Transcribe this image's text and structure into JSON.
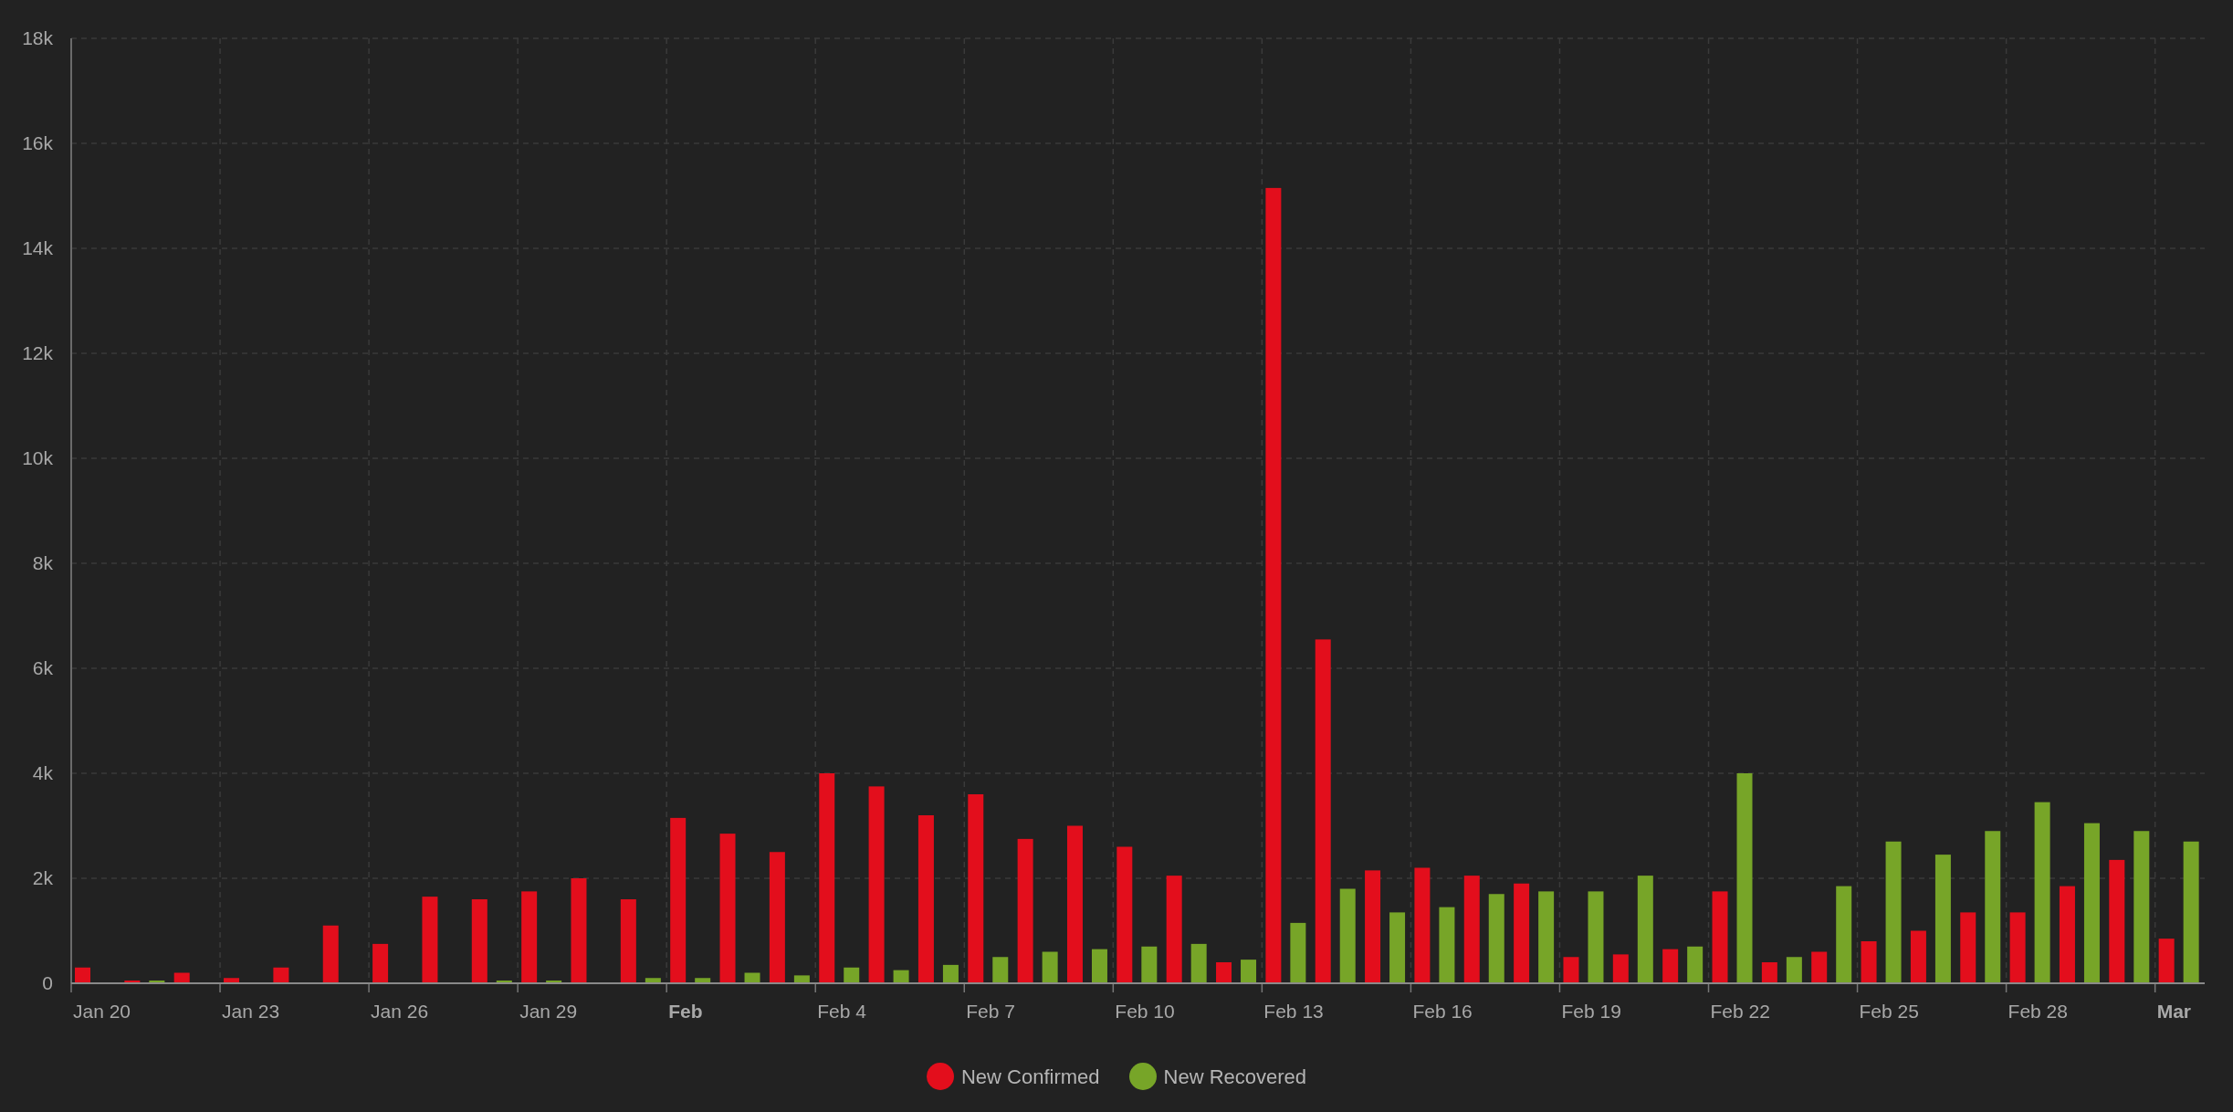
{
  "chart_data": {
    "type": "bar",
    "orientation": "vertical",
    "stacked": false,
    "grid": true,
    "categories": [
      "Jan 20",
      null,
      null,
      "Jan 23",
      null,
      null,
      "Jan 26",
      null,
      null,
      "Jan 29",
      null,
      null,
      "Feb",
      null,
      null,
      "Feb 4",
      null,
      null,
      "Feb 7",
      null,
      null,
      "Feb 10",
      null,
      null,
      "Feb 13",
      null,
      null,
      "Feb 16",
      null,
      null,
      "Feb 19",
      null,
      null,
      "Feb 22",
      null,
      null,
      "Feb 25",
      null,
      null,
      "Feb 28",
      null,
      null,
      "Mar"
    ],
    "series": [
      {
        "name": "New Confirmed",
        "color": "#e30e1c",
        "values": [
          300,
          50,
          200,
          100,
          300,
          1100,
          750,
          1650,
          1600,
          1750,
          2000,
          1600,
          3150,
          2850,
          2500,
          4000,
          3750,
          3200,
          3600,
          2750,
          3000,
          2600,
          2050,
          400,
          15150,
          6550,
          2150,
          2200,
          2050,
          1900,
          500,
          550,
          650,
          1750,
          400,
          600,
          800,
          1000,
          1350,
          1350,
          1850,
          2350,
          850
        ]
      },
      {
        "name": "New Recovered",
        "color": "#77a528",
        "values": [
          0,
          50,
          0,
          0,
          0,
          0,
          0,
          0,
          50,
          50,
          0,
          100,
          100,
          200,
          150,
          300,
          250,
          350,
          500,
          600,
          650,
          700,
          750,
          450,
          1150,
          1800,
          1350,
          1450,
          1700,
          1750,
          1750,
          2050,
          700,
          4000,
          500,
          1850,
          2700,
          2450,
          2900,
          3450,
          3050,
          2900,
          2700
        ]
      }
    ],
    "ylim": [
      0,
      18000
    ],
    "yticks": [
      {
        "value": 0,
        "label": "0"
      },
      {
        "value": 2000,
        "label": "2k"
      },
      {
        "value": 4000,
        "label": "4k"
      },
      {
        "value": 6000,
        "label": "6k"
      },
      {
        "value": 8000,
        "label": "8k"
      },
      {
        "value": 10000,
        "label": "10k"
      },
      {
        "value": 12000,
        "label": "12k"
      },
      {
        "value": 14000,
        "label": "14k"
      },
      {
        "value": 16000,
        "label": "16k"
      },
      {
        "value": 18000,
        "label": "18k"
      }
    ]
  }
}
